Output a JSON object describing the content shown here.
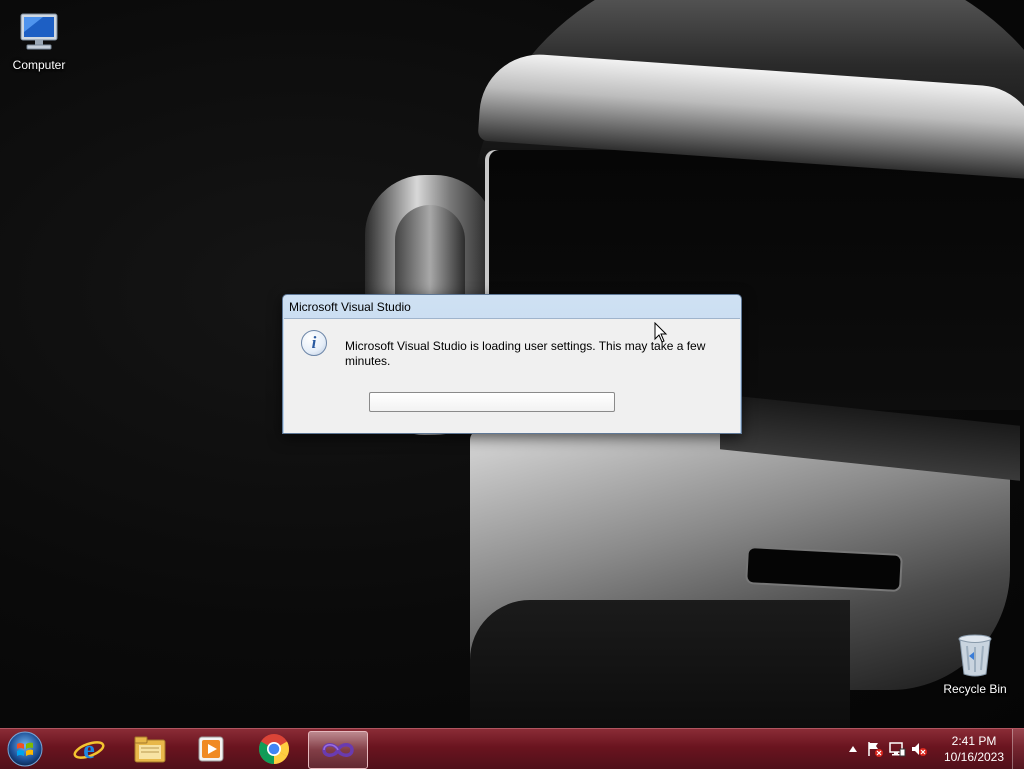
{
  "desktop": {
    "icons": [
      {
        "label": "Computer"
      },
      {
        "label": "Recycle Bin"
      }
    ]
  },
  "dialog": {
    "title": "Microsoft Visual Studio",
    "message": "Microsoft Visual Studio is loading user settings. This may take a few minutes.",
    "icon": "info-icon",
    "progress": 0
  },
  "taskbar": {
    "start": "windows-start-orb-icon",
    "pinned": [
      {
        "name": "internet-explorer-icon"
      },
      {
        "name": "file-explorer-icon"
      },
      {
        "name": "media-player-icon"
      },
      {
        "name": "chrome-icon"
      },
      {
        "name": "visual-studio-icon",
        "active": true
      }
    ],
    "tray": {
      "icons": [
        "show-hidden-icons-chevron",
        "action-center-flag-icon",
        "network-icon",
        "volume-muted-icon"
      ],
      "time": "2:41 PM",
      "date": "10/16/2023"
    },
    "accent": "#6a141f"
  }
}
